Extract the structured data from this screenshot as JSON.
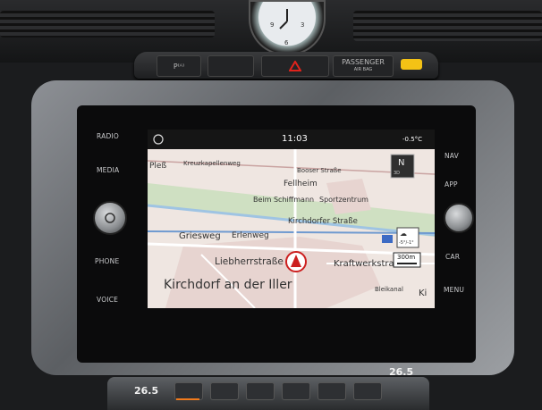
{
  "console": {
    "strip": {
      "p_label": "P⁽ᴬ⁾",
      "airbag_label": "PASSENGER",
      "airbag_sub": "AIR BAG"
    },
    "side_left": [
      "RADIO",
      "MEDIA",
      "PHONE",
      "VOICE"
    ],
    "side_right": [
      "NAV",
      "APP",
      "CAR",
      "MENU"
    ]
  },
  "screen": {
    "time": "11:03",
    "temperature": "-0.5°C",
    "streets": {
      "s1": "Pleß",
      "s2": "Kreuzkapellenweg",
      "s3": "Booser Straße",
      "s4": "Fellheim",
      "s5": "Beim Schiffmann",
      "s6": "Sportzentrum",
      "s7": "Kirchdorfer Straße",
      "s8": "Griesweg",
      "s9": "Erlenweg",
      "s10": "Liebherrstraße",
      "s11": "Kraftwerkstra",
      "s12": "Kirchdorf an der Iller",
      "s13": "Bleikanal",
      "s14": "Ki"
    },
    "compass_label": "N",
    "compass_sub": "3D",
    "scale_label": "300m",
    "weather_temp": "-5°/-1°",
    "colors": {
      "water": "#9fc4e3",
      "green": "#cfe0c2",
      "urban": "#e7d4d0",
      "road_main": "#ffffff",
      "accent_red": "#cc1f1f"
    }
  },
  "climate": {
    "temp_left": "26.5",
    "temp_right": "26.5"
  }
}
